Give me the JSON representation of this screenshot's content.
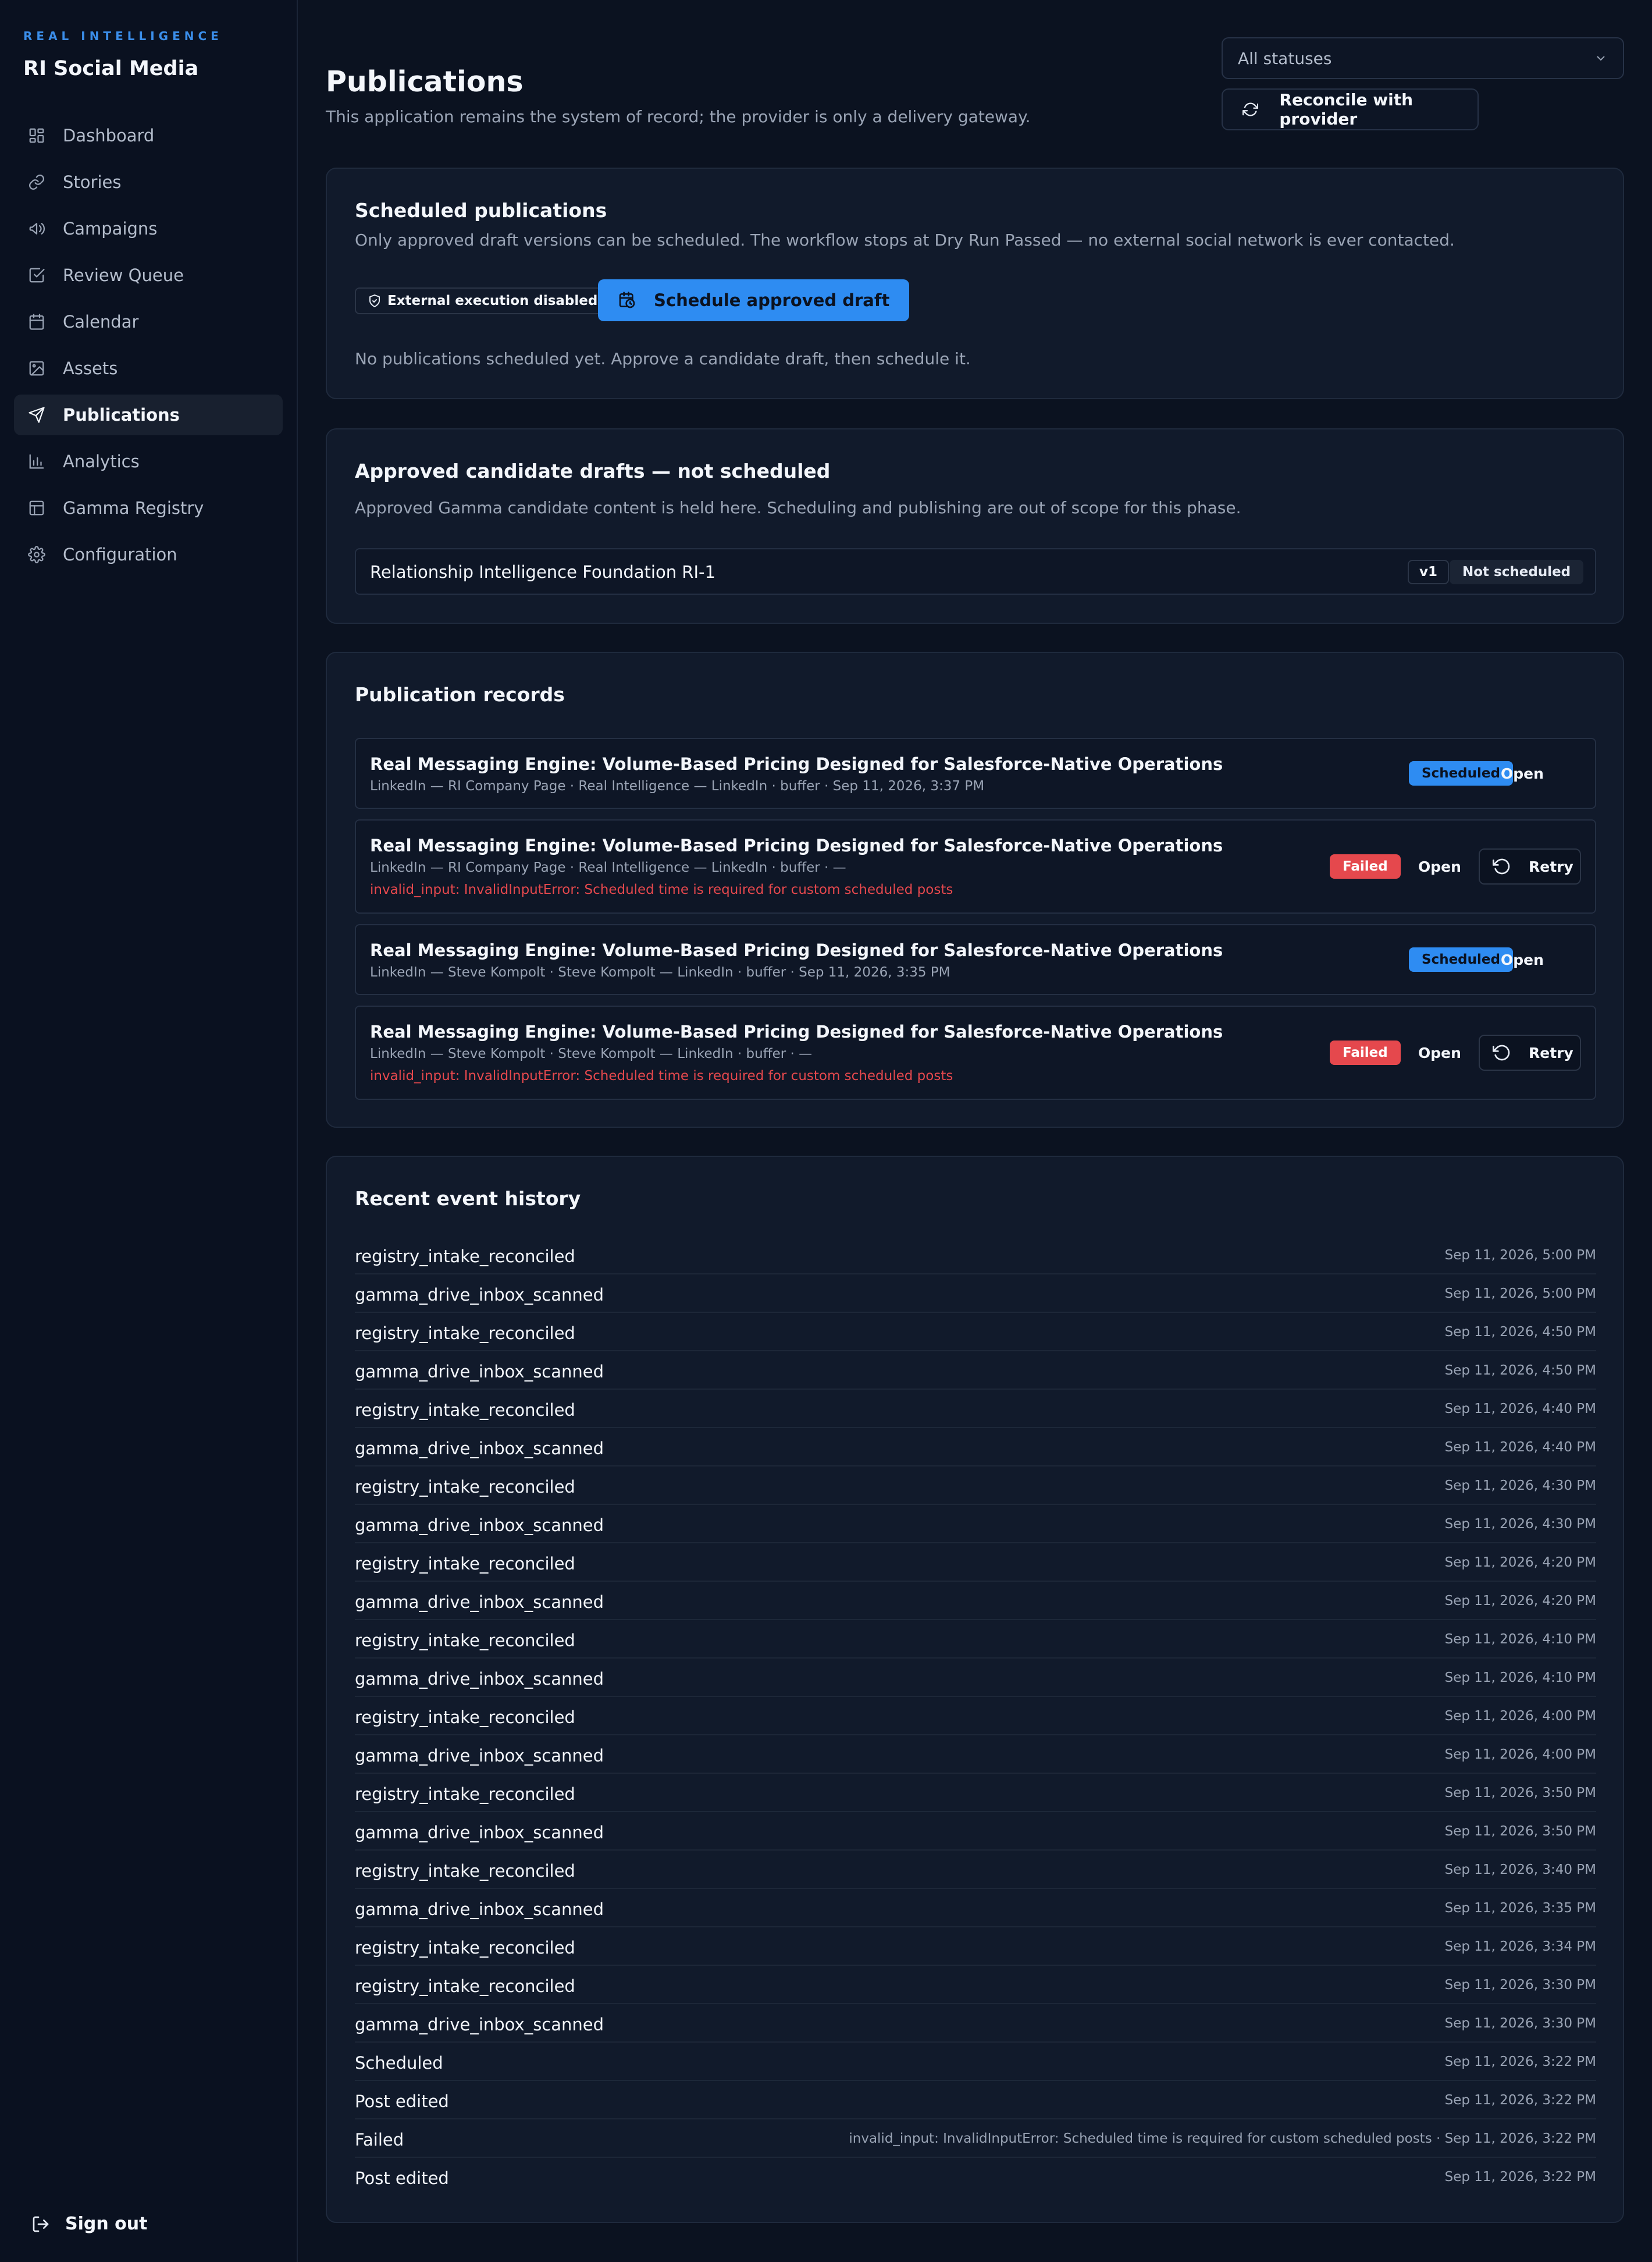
{
  "brand": {
    "kicker": "REAL INTELLIGENCE",
    "title": "RI Social Media"
  },
  "nav": [
    {
      "label": "Dashboard",
      "icon": "dashboard-icon"
    },
    {
      "label": "Stories",
      "icon": "stories-icon"
    },
    {
      "label": "Campaigns",
      "icon": "megaphone-icon"
    },
    {
      "label": "Review Queue",
      "icon": "check-square-icon"
    },
    {
      "label": "Calendar",
      "icon": "calendar-icon"
    },
    {
      "label": "Assets",
      "icon": "image-icon"
    },
    {
      "label": "Publications",
      "icon": "send-icon",
      "active": true
    },
    {
      "label": "Analytics",
      "icon": "bar-chart-icon"
    },
    {
      "label": "Gamma Registry",
      "icon": "table-icon"
    },
    {
      "label": "Configuration",
      "icon": "gear-icon"
    }
  ],
  "signout": "Sign out",
  "header": {
    "title": "Publications",
    "subtitle": "This application remains the system of record; the provider is only a delivery gateway.",
    "status_filter": "All statuses",
    "reconcile": "Reconcile with provider"
  },
  "scheduled": {
    "title": "Scheduled publications",
    "description": "Only approved draft versions can be scheduled. The workflow stops at Dry Run Passed — no external social network is ever contacted.",
    "external_badge": "External execution disabled",
    "schedule_button": "Schedule approved draft",
    "empty": "No publications scheduled yet. Approve a candidate draft, then schedule it."
  },
  "drafts": {
    "title": "Approved candidate drafts — not scheduled",
    "description": "Approved Gamma candidate content is held here. Scheduling and publishing are out of scope for this phase.",
    "items": [
      {
        "name": "Relationship Intelligence Foundation RI-1",
        "version": "v1",
        "status": "Not scheduled"
      }
    ]
  },
  "records": {
    "title": "Publication records",
    "open_label": "Open",
    "retry_label": "Retry",
    "items": [
      {
        "title": "Real Messaging Engine: Volume-Based Pricing Designed for Salesforce-Native Operations",
        "meta": "LinkedIn — RI Company Page · Real Intelligence — LinkedIn · buffer · Sep 11, 2026, 3:37 PM",
        "status": "Scheduled",
        "error": ""
      },
      {
        "title": "Real Messaging Engine: Volume-Based Pricing Designed for Salesforce-Native Operations",
        "meta": "LinkedIn — RI Company Page · Real Intelligence — LinkedIn · buffer · —",
        "status": "Failed",
        "error": "invalid_input: InvalidInputError: Scheduled time is required for custom scheduled posts"
      },
      {
        "title": "Real Messaging Engine: Volume-Based Pricing Designed for Salesforce-Native Operations",
        "meta": "LinkedIn — Steve Kompolt · Steve Kompolt — LinkedIn · buffer · Sep 11, 2026, 3:35 PM",
        "status": "Scheduled",
        "error": ""
      },
      {
        "title": "Real Messaging Engine: Volume-Based Pricing Designed for Salesforce-Native Operations",
        "meta": "LinkedIn — Steve Kompolt · Steve Kompolt — LinkedIn · buffer · —",
        "status": "Failed",
        "error": "invalid_input: InvalidInputError: Scheduled time is required for custom scheduled posts"
      }
    ]
  },
  "events": {
    "title": "Recent event history",
    "items": [
      {
        "name": "registry_intake_reconciled",
        "time": "Sep 11, 2026, 5:00 PM"
      },
      {
        "name": "gamma_drive_inbox_scanned",
        "time": "Sep 11, 2026, 5:00 PM"
      },
      {
        "name": "registry_intake_reconciled",
        "time": "Sep 11, 2026, 4:50 PM"
      },
      {
        "name": "gamma_drive_inbox_scanned",
        "time": "Sep 11, 2026, 4:50 PM"
      },
      {
        "name": "registry_intake_reconciled",
        "time": "Sep 11, 2026, 4:40 PM"
      },
      {
        "name": "gamma_drive_inbox_scanned",
        "time": "Sep 11, 2026, 4:40 PM"
      },
      {
        "name": "registry_intake_reconciled",
        "time": "Sep 11, 2026, 4:30 PM"
      },
      {
        "name": "gamma_drive_inbox_scanned",
        "time": "Sep 11, 2026, 4:30 PM"
      },
      {
        "name": "registry_intake_reconciled",
        "time": "Sep 11, 2026, 4:20 PM"
      },
      {
        "name": "gamma_drive_inbox_scanned",
        "time": "Sep 11, 2026, 4:20 PM"
      },
      {
        "name": "registry_intake_reconciled",
        "time": "Sep 11, 2026, 4:10 PM"
      },
      {
        "name": "gamma_drive_inbox_scanned",
        "time": "Sep 11, 2026, 4:10 PM"
      },
      {
        "name": "registry_intake_reconciled",
        "time": "Sep 11, 2026, 4:00 PM"
      },
      {
        "name": "gamma_drive_inbox_scanned",
        "time": "Sep 11, 2026, 4:00 PM"
      },
      {
        "name": "registry_intake_reconciled",
        "time": "Sep 11, 2026, 3:50 PM"
      },
      {
        "name": "gamma_drive_inbox_scanned",
        "time": "Sep 11, 2026, 3:50 PM"
      },
      {
        "name": "registry_intake_reconciled",
        "time": "Sep 11, 2026, 3:40 PM"
      },
      {
        "name": "gamma_drive_inbox_scanned",
        "time": "Sep 11, 2026, 3:35 PM"
      },
      {
        "name": "registry_intake_reconciled",
        "time": "Sep 11, 2026, 3:34 PM"
      },
      {
        "name": "registry_intake_reconciled",
        "time": "Sep 11, 2026, 3:30 PM"
      },
      {
        "name": "gamma_drive_inbox_scanned",
        "time": "Sep 11, 2026, 3:30 PM"
      },
      {
        "name": "Scheduled",
        "time": "Sep 11, 2026, 3:22 PM"
      },
      {
        "name": "Post edited",
        "time": "Sep 11, 2026, 3:22 PM"
      },
      {
        "name": "Failed",
        "time": "invalid_input: InvalidInputError: Scheduled time is required for custom scheduled posts · Sep 11, 2026, 3:22 PM"
      },
      {
        "name": "Post edited",
        "time": "Sep 11, 2026, 3:22 PM"
      }
    ]
  }
}
